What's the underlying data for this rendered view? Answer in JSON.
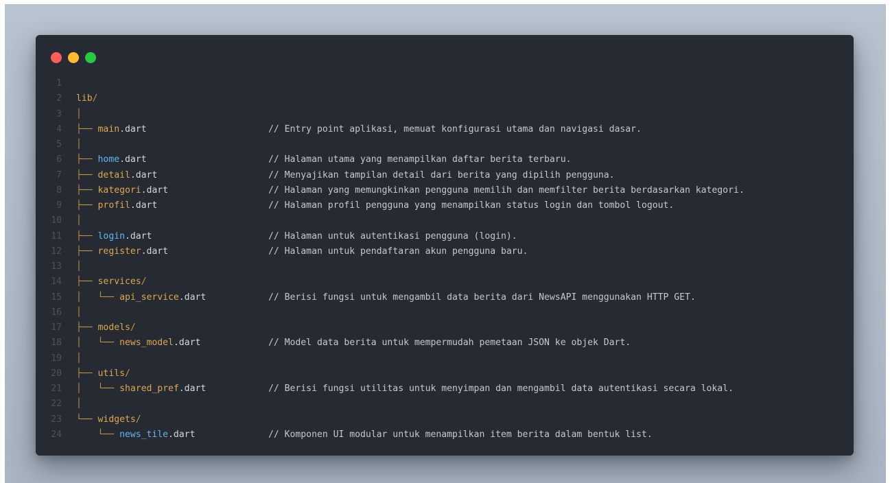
{
  "colors": {
    "backdrop": "#b0bcc8",
    "window_bg": "#262b33",
    "close_dot": "#ff5f56",
    "minimize_dot": "#ffbd2e",
    "maximize_dot": "#27c93f",
    "line_number": "#4a5260",
    "tree_glyph": "#c7923d",
    "name_default": "#e0a74a",
    "name_highlight": "#62b7ee",
    "extension": "#d3d8df",
    "comment": "#c3c9d2"
  },
  "window": {
    "controls": [
      "close-dot",
      "minimize-dot",
      "maximize-dot"
    ]
  },
  "lines": [
    {
      "n": "1",
      "prefix": "",
      "name": "",
      "ext": "",
      "comment": "",
      "hl": false
    },
    {
      "n": "2",
      "prefix": "",
      "name": "lib",
      "ext": "/",
      "comment": "",
      "hl": false
    },
    {
      "n": "3",
      "prefix": "│",
      "name": "",
      "ext": "",
      "comment": "",
      "hl": false
    },
    {
      "n": "4",
      "prefix": "├── ",
      "name": "main",
      "ext": ".dart",
      "comment": "// Entry point aplikasi, memuat konfigurasi utama dan navigasi dasar.",
      "hl": false
    },
    {
      "n": "5",
      "prefix": "│",
      "name": "",
      "ext": "",
      "comment": "",
      "hl": false
    },
    {
      "n": "6",
      "prefix": "├── ",
      "name": "home",
      "ext": ".dart",
      "comment": "// Halaman utama yang menampilkan daftar berita terbaru.",
      "hl": true
    },
    {
      "n": "7",
      "prefix": "├── ",
      "name": "detail",
      "ext": ".dart",
      "comment": "// Menyajikan tampilan detail dari berita yang dipilih pengguna.",
      "hl": false
    },
    {
      "n": "8",
      "prefix": "├── ",
      "name": "kategori",
      "ext": ".dart",
      "comment": "// Halaman yang memungkinkan pengguna memilih dan memfilter berita berdasarkan kategori.",
      "hl": false
    },
    {
      "n": "9",
      "prefix": "├── ",
      "name": "profil",
      "ext": ".dart",
      "comment": "// Halaman profil pengguna yang menampilkan status login dan tombol logout.",
      "hl": false
    },
    {
      "n": "10",
      "prefix": "│",
      "name": "",
      "ext": "",
      "comment": "",
      "hl": false
    },
    {
      "n": "11",
      "prefix": "├── ",
      "name": "login",
      "ext": ".dart",
      "comment": "// Halaman untuk autentikasi pengguna (login).",
      "hl": true
    },
    {
      "n": "12",
      "prefix": "├── ",
      "name": "register",
      "ext": ".dart",
      "comment": "// Halaman untuk pendaftaran akun pengguna baru.",
      "hl": false
    },
    {
      "n": "13",
      "prefix": "│",
      "name": "",
      "ext": "",
      "comment": "",
      "hl": false
    },
    {
      "n": "14",
      "prefix": "├── ",
      "name": "services",
      "ext": "/",
      "comment": "",
      "hl": false
    },
    {
      "n": "15",
      "prefix": "│   └── ",
      "name": "api_service",
      "ext": ".dart",
      "comment": "// Berisi fungsi untuk mengambil data berita dari NewsAPI menggunakan HTTP GET.",
      "hl": false
    },
    {
      "n": "16",
      "prefix": "│",
      "name": "",
      "ext": "",
      "comment": "",
      "hl": false
    },
    {
      "n": "17",
      "prefix": "├── ",
      "name": "models",
      "ext": "/",
      "comment": "",
      "hl": false
    },
    {
      "n": "18",
      "prefix": "│   └── ",
      "name": "news_model",
      "ext": ".dart",
      "comment": "// Model data berita untuk mempermudah pemetaan JSON ke objek Dart.",
      "hl": false
    },
    {
      "n": "19",
      "prefix": "│",
      "name": "",
      "ext": "",
      "comment": "",
      "hl": false
    },
    {
      "n": "20",
      "prefix": "├── ",
      "name": "utils",
      "ext": "/",
      "comment": "",
      "hl": false
    },
    {
      "n": "21",
      "prefix": "│   └── ",
      "name": "shared_pref",
      "ext": ".dart",
      "comment": "// Berisi fungsi utilitas untuk menyimpan dan mengambil data autentikasi secara lokal.",
      "hl": false
    },
    {
      "n": "22",
      "prefix": "│",
      "name": "",
      "ext": "",
      "comment": "",
      "hl": false
    },
    {
      "n": "23",
      "prefix": "└── ",
      "name": "widgets",
      "ext": "/",
      "comment": "",
      "hl": false
    },
    {
      "n": "24",
      "prefix": "    └── ",
      "name": "news_tile",
      "ext": ".dart",
      "comment": "// Komponen UI modular untuk menampilkan item berita dalam bentuk list.",
      "hl": true
    }
  ]
}
